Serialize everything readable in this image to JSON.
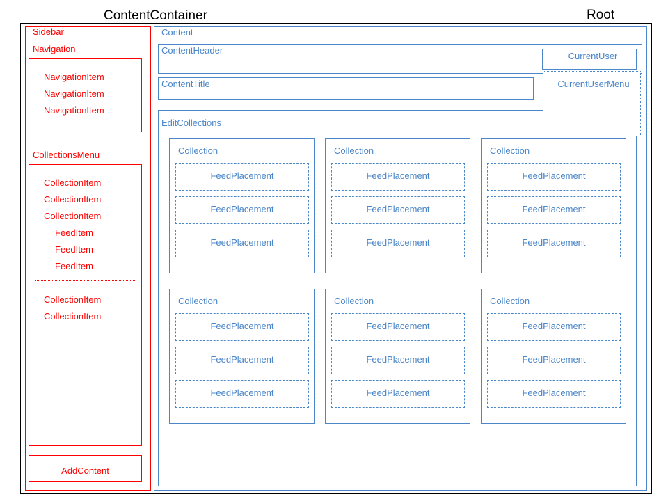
{
  "colors": {
    "sidebar": "#ff0000",
    "content": "#4a86c8",
    "root": "#000000"
  },
  "labels": {
    "content_container": "ContentContainer",
    "root": "Root",
    "sidebar": "Sidebar",
    "navigation": "Navigation",
    "navigation_item": "NavigationItem",
    "collections_menu": "CollectionsMenu",
    "collection_item": "CollectionItem",
    "feed_item": "FeedItem",
    "add_content": "AddContent",
    "content": "Content",
    "content_header": "ContentHeader",
    "current_user": "CurrentUser",
    "current_user_menu": "CurrentUserMenu",
    "content_title": "ContentTitle",
    "edit_collections": "EditCollections",
    "collection": "Collection",
    "feed_placement": "FeedPlacement"
  }
}
